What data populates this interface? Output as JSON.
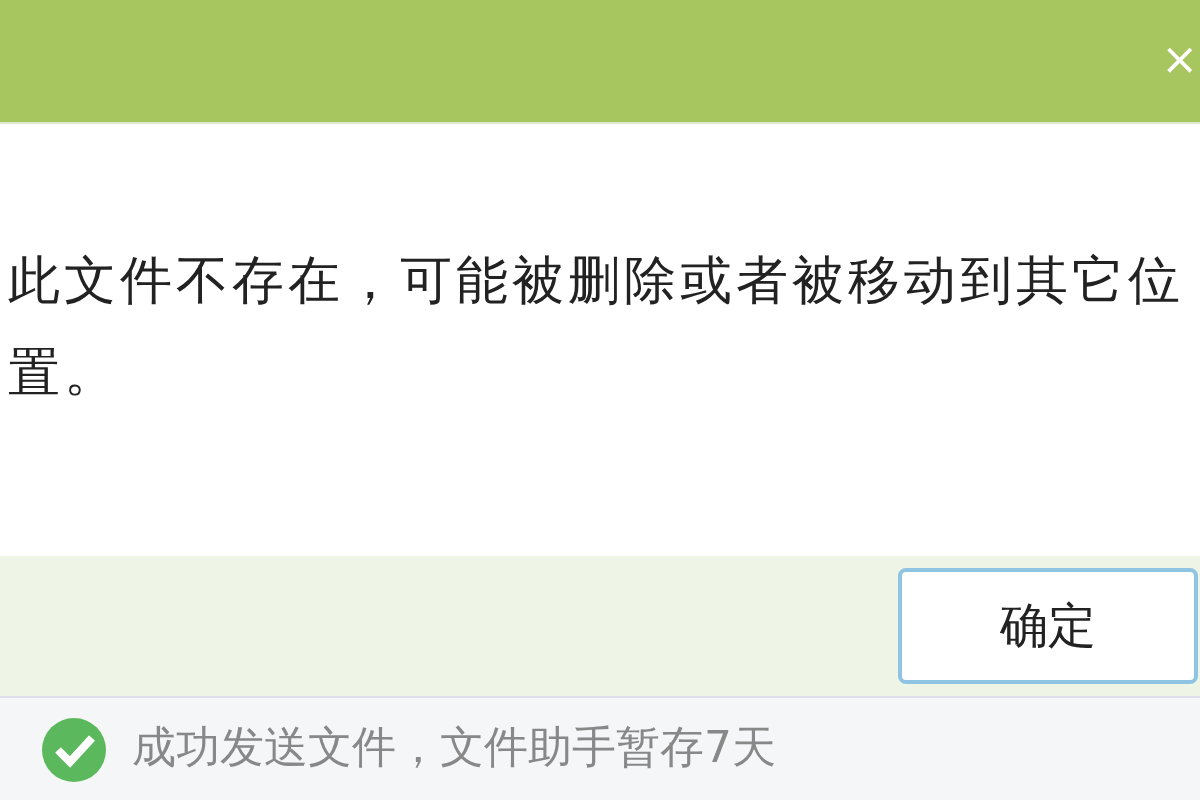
{
  "dialog": {
    "close_label": "×",
    "message": "此文件不存在，可能被删除或者被移动到其它位置。",
    "buttons": [
      "确定"
    ]
  },
  "status_bar": {
    "text": "成功发送文件，文件助手暂存7天"
  }
}
